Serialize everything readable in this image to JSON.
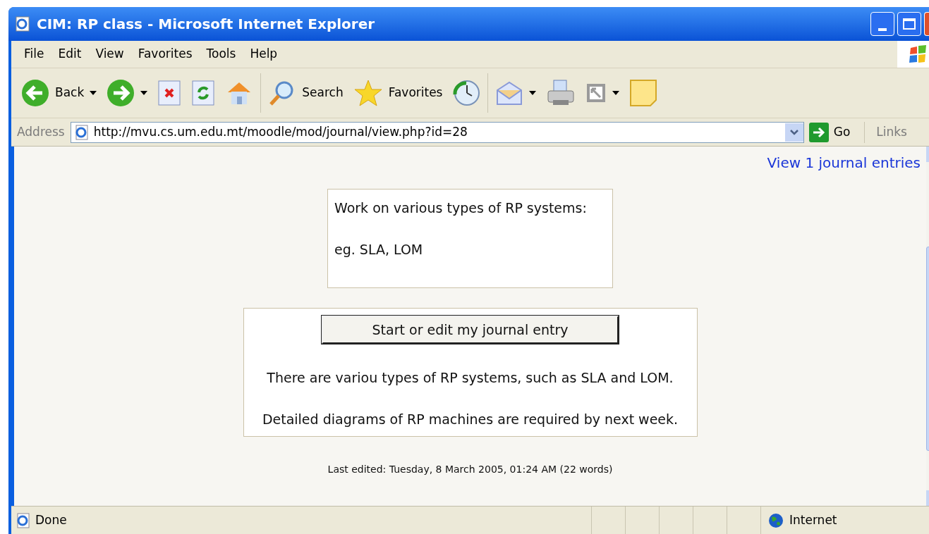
{
  "window": {
    "title": "CIM: RP class - Microsoft Internet Explorer"
  },
  "menu": [
    "File",
    "Edit",
    "View",
    "Favorites",
    "Tools",
    "Help"
  ],
  "toolbar": [
    {
      "kind": "back",
      "label": "Back"
    },
    {
      "kind": "forward"
    },
    {
      "kind": "stop"
    },
    {
      "kind": "refresh"
    },
    {
      "kind": "home"
    },
    {
      "kind": "search",
      "label": "Search"
    },
    {
      "kind": "favorites",
      "label": "Favorites"
    },
    {
      "kind": "history"
    },
    {
      "kind": "mail"
    },
    {
      "kind": "print"
    },
    {
      "kind": "resize"
    },
    {
      "kind": "note"
    }
  ],
  "address_bar": {
    "label": "Address",
    "url": "http://mvu.cs.um.edu.mt/moodle/mod/journal/view.php?id=28",
    "go": "Go",
    "links": "Links"
  },
  "page": {
    "entries_link": "View 1 journal entries",
    "intro": [
      "Work on various types of RP systems:",
      "eg. SLA, LOM"
    ],
    "edit_button": "Start or edit my journal entry",
    "entry": [
      "There are variou types of RP systems, such as SLA and LOM.",
      "Detailed diagrams of RP machines are required by next week."
    ],
    "last_edited": "Last edited: Tuesday, 8 March 2005, 01:24 AM (22 words)"
  },
  "status_bar": {
    "text": "Done",
    "zone": "Internet"
  }
}
